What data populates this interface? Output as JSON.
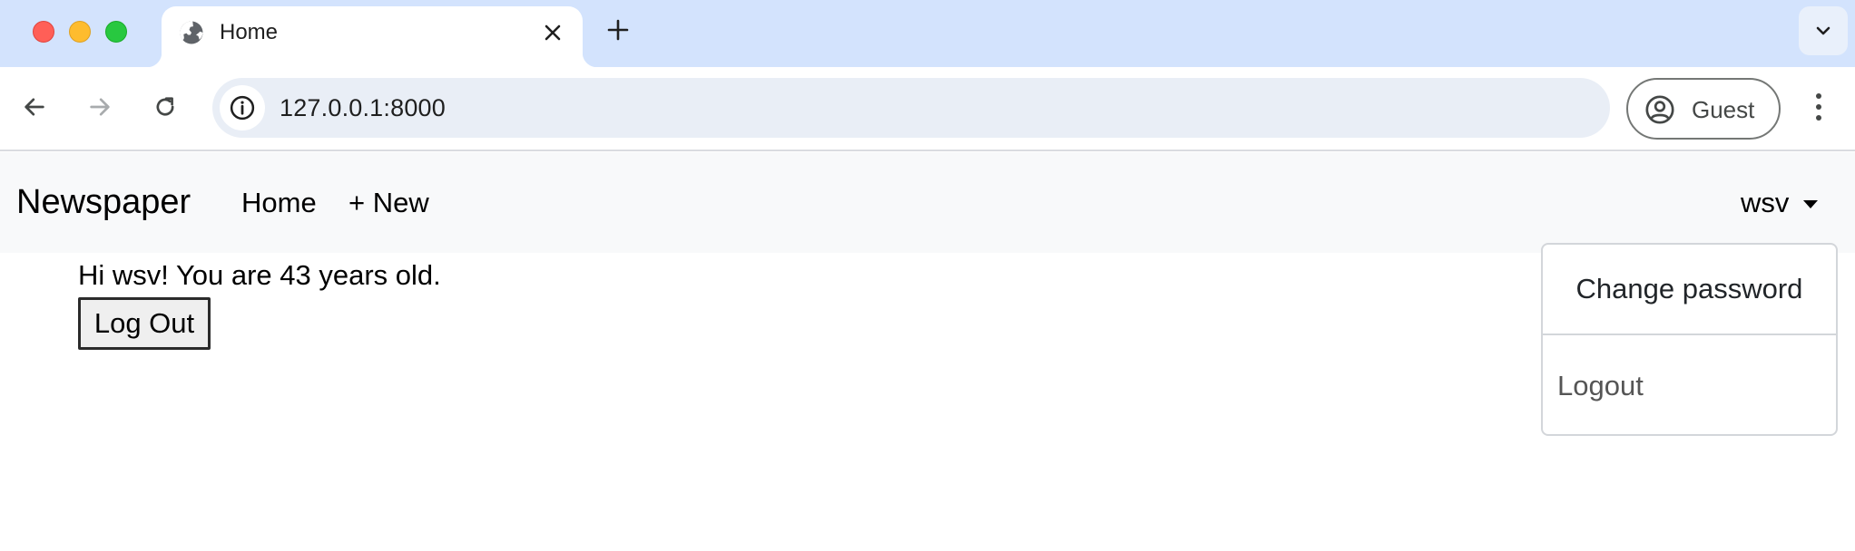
{
  "browser": {
    "tab": {
      "title": "Home",
      "favicon": "globe-icon",
      "close_icon": "close-icon"
    },
    "new_tab_icon": "plus-icon",
    "tab_search_icon": "chevron-down-icon",
    "toolbar": {
      "back_icon": "arrow-left-icon",
      "forward_icon": "arrow-right-icon",
      "reload_icon": "reload-icon",
      "site_info_icon": "info-icon",
      "url": "127.0.0.1:8000",
      "profile": {
        "icon": "account-circle-icon",
        "label": "Guest"
      },
      "menu_icon": "kebab-menu-icon"
    },
    "colors": {
      "tabstrip": "#d3e3fd",
      "omnibox": "#e9eef6",
      "close": "#ff5f57",
      "minimize": "#febc2e",
      "zoom": "#28c840"
    }
  },
  "page": {
    "navbar": {
      "brand": "Newspaper",
      "links": [
        {
          "label": "Home"
        },
        {
          "label": "+ New"
        }
      ],
      "user": {
        "label": "wsv",
        "icon": "caret-down-icon"
      }
    },
    "greeting": "Hi wsv! You are 43 years old.",
    "logout_button": "Log Out",
    "dropdown": {
      "items": [
        {
          "label": "Change password"
        },
        {
          "label": "Logout"
        }
      ]
    },
    "colors": {
      "navbar_bg": "#f8f9fa"
    }
  }
}
